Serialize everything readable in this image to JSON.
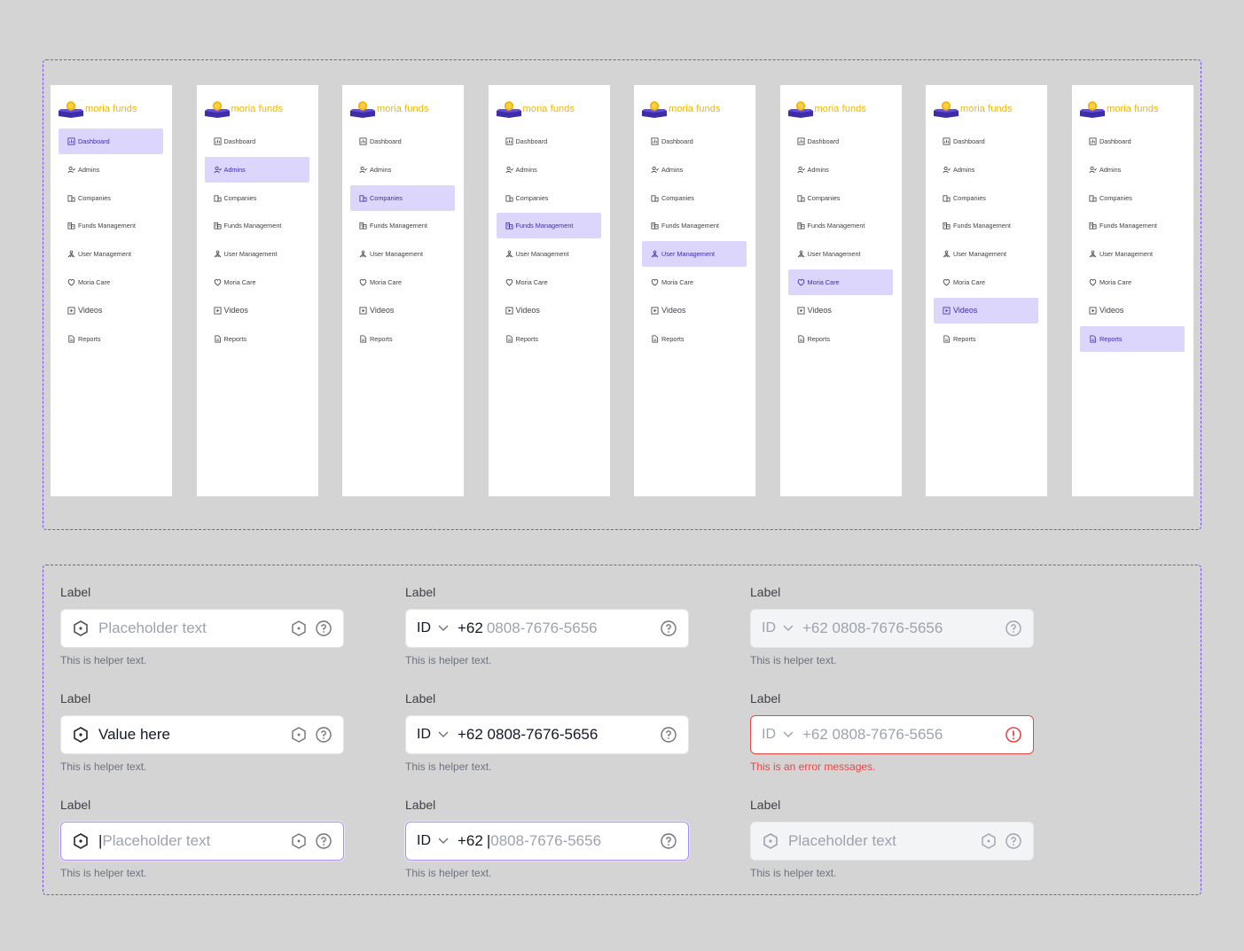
{
  "brand": {
    "name": "moria funds",
    "color": "#f2b705",
    "accent": "#7b4cf0",
    "active_bg": "#dcd6fd"
  },
  "nav_items": [
    {
      "label": "Dashboard",
      "icon": "dashboard-icon"
    },
    {
      "label": "Admins",
      "icon": "admins-icon"
    },
    {
      "label": "Companies",
      "icon": "companies-icon"
    },
    {
      "label": "Funds Management",
      "icon": "funds-icon"
    },
    {
      "label": "User Management",
      "icon": "user-management-icon"
    },
    {
      "label": "Moria Care",
      "icon": "heart-icon"
    },
    {
      "label": "Videos",
      "icon": "video-icon"
    },
    {
      "label": "Reports",
      "icon": "report-icon"
    }
  ],
  "sidebars_active": [
    0,
    1,
    2,
    3,
    4,
    5,
    6,
    7
  ],
  "inputs": {
    "label": "Label",
    "helper": "This is helper text.",
    "error_message": "This is an error messages.",
    "placeholder": "Placeholder text",
    "value": "Value here",
    "country_code": "ID",
    "prefix": "+62",
    "phone": "0808-7676-5656",
    "phone_full": "+62 0808-7676-5656"
  }
}
